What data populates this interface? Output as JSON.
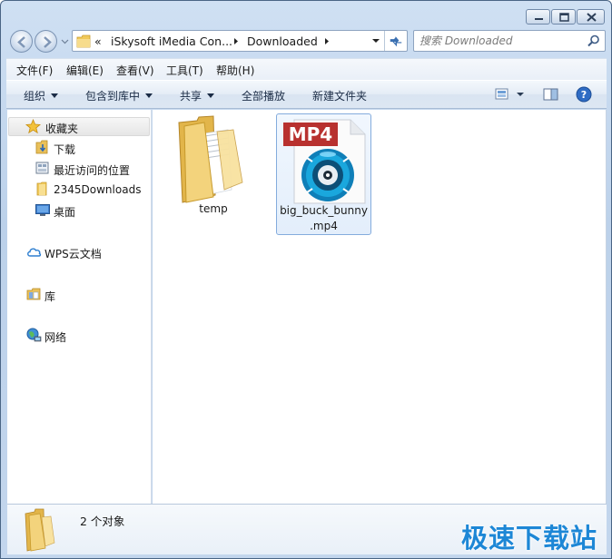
{
  "window": {
    "controls": [
      "minimize",
      "maximize",
      "close"
    ]
  },
  "address_bar": {
    "overflow": "«",
    "segments": [
      "iSkysoft iMedia Con...",
      "Downloaded"
    ]
  },
  "search": {
    "placeholder": "搜索 Downloaded"
  },
  "menu": {
    "items": [
      "文件(F)",
      "编辑(E)",
      "查看(V)",
      "工具(T)",
      "帮助(H)"
    ]
  },
  "toolbar": {
    "organize": "组织",
    "include_in_library": "包含到库中",
    "share": "共享",
    "play_all": "全部播放",
    "new_folder": "新建文件夹"
  },
  "nav": {
    "favorites": "收藏夹",
    "favorite_items": [
      "下载",
      "最近访问的位置",
      "2345Downloads",
      "桌面"
    ],
    "wps": "WPS云文档",
    "libraries": "库",
    "network": "网络"
  },
  "files": [
    {
      "name": "temp",
      "type": "folder"
    },
    {
      "name_line1": "big_buck_bunny",
      "name_line2": ".mp4",
      "badge": "MP4",
      "type": "video",
      "selected": true
    }
  ],
  "status": {
    "count": "2 个对象"
  },
  "watermark": "极速下载站",
  "colors": {
    "accent": "#1d87d6",
    "mp4_badge": "#b8312f",
    "folder": "#f2cf6a",
    "selection": "#84acdd"
  }
}
